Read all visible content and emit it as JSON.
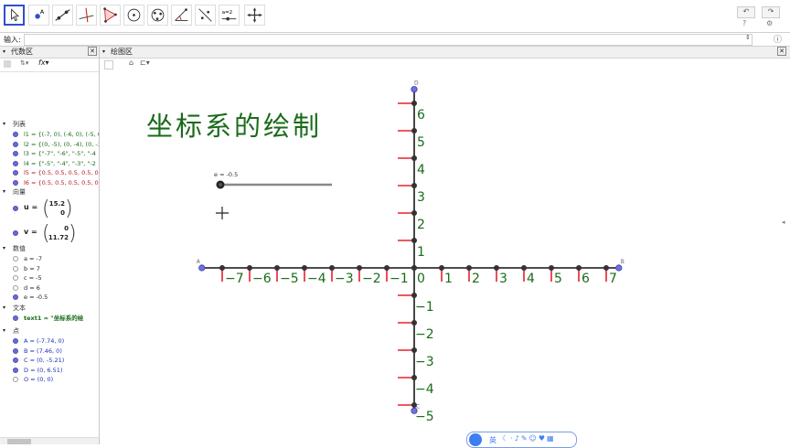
{
  "toolbar": {
    "tools": [
      "move-tool",
      "point-tool",
      "line-tool",
      "perpendicular-tool",
      "polygon-tool",
      "circle-tool",
      "conic-tool",
      "angle-tool",
      "reflect-tool",
      "slider-tool",
      "move-view-tool"
    ],
    "slider_tool_label": "a=2",
    "undo_icon": "undo-icon",
    "help_icon": "help-icon",
    "settings_icon": "settings-icon"
  },
  "input": {
    "label": "输入:",
    "value": ""
  },
  "algebra": {
    "title": "代数区",
    "categories": {
      "lists": "列表",
      "vectors": "向量",
      "numbers": "数值",
      "text": "文本",
      "points": "点"
    },
    "lists": [
      {
        "text": "l1 = {(-7, 0), (-6, 0), (-5, 0",
        "on": true
      },
      {
        "text": "l2 = {(0, -5), (0, -4), (0, -3",
        "on": true
      },
      {
        "text": "l3 = {\"-7\", \"-6\", \"-5\", \"-4",
        "on": true
      },
      {
        "text": "l4 = {\"-5\", \"-4\", \"-3\", \"-2",
        "on": true
      },
      {
        "text": "l5 = {0.5, 0.5, 0.5, 0.5, 0.5",
        "on": true
      },
      {
        "text": "l6 = {0.5, 0.5, 0.5, 0.5, 0.5",
        "on": true
      }
    ],
    "vectors": [
      {
        "name": "u =",
        "top": "15.2",
        "bottom": "0"
      },
      {
        "name": "v =",
        "top": "0",
        "bottom": "11.72"
      }
    ],
    "numbers": [
      {
        "text": "a = -7",
        "on": false
      },
      {
        "text": "b = 7",
        "on": false
      },
      {
        "text": "c = -5",
        "on": false
      },
      {
        "text": "d = 6",
        "on": false
      },
      {
        "text": "e = -0.5",
        "on": true
      }
    ],
    "texts": [
      {
        "text": "text1 = \"坐标系的绘",
        "on": true
      }
    ],
    "points": [
      {
        "text": "A = (-7.74, 0)",
        "on": true
      },
      {
        "text": "B = (7.46, 0)",
        "on": true
      },
      {
        "text": "C = (0, -5.21)",
        "on": true
      },
      {
        "text": "D = (0, 6.51)",
        "on": true
      },
      {
        "text": "O = (0, 0)",
        "on": false
      }
    ]
  },
  "graphics": {
    "title": "绘图区",
    "heading": "坐标系的绘制",
    "slider_label": "e = -0.5",
    "point_labels": {
      "A": "A",
      "B": "B",
      "C": "C",
      "D": "D"
    },
    "x_ticks": [
      "−7",
      "−6",
      "−5",
      "−4",
      "−3",
      "−2",
      "−1",
      "0",
      "1",
      "2",
      "3",
      "4",
      "5",
      "6",
      "7"
    ],
    "y_ticks_pos": [
      "6",
      "5",
      "4",
      "3",
      "2",
      "1"
    ],
    "y_ticks_neg": [
      "−1",
      "−2",
      "−3",
      "−4",
      "−5"
    ],
    "colors": {
      "axis": "#333333",
      "tick": "#e8202a",
      "dot": "#333333",
      "label": "#1a6b1a",
      "endpoint": "#7070e0"
    }
  },
  "ime": {
    "label": "英"
  }
}
